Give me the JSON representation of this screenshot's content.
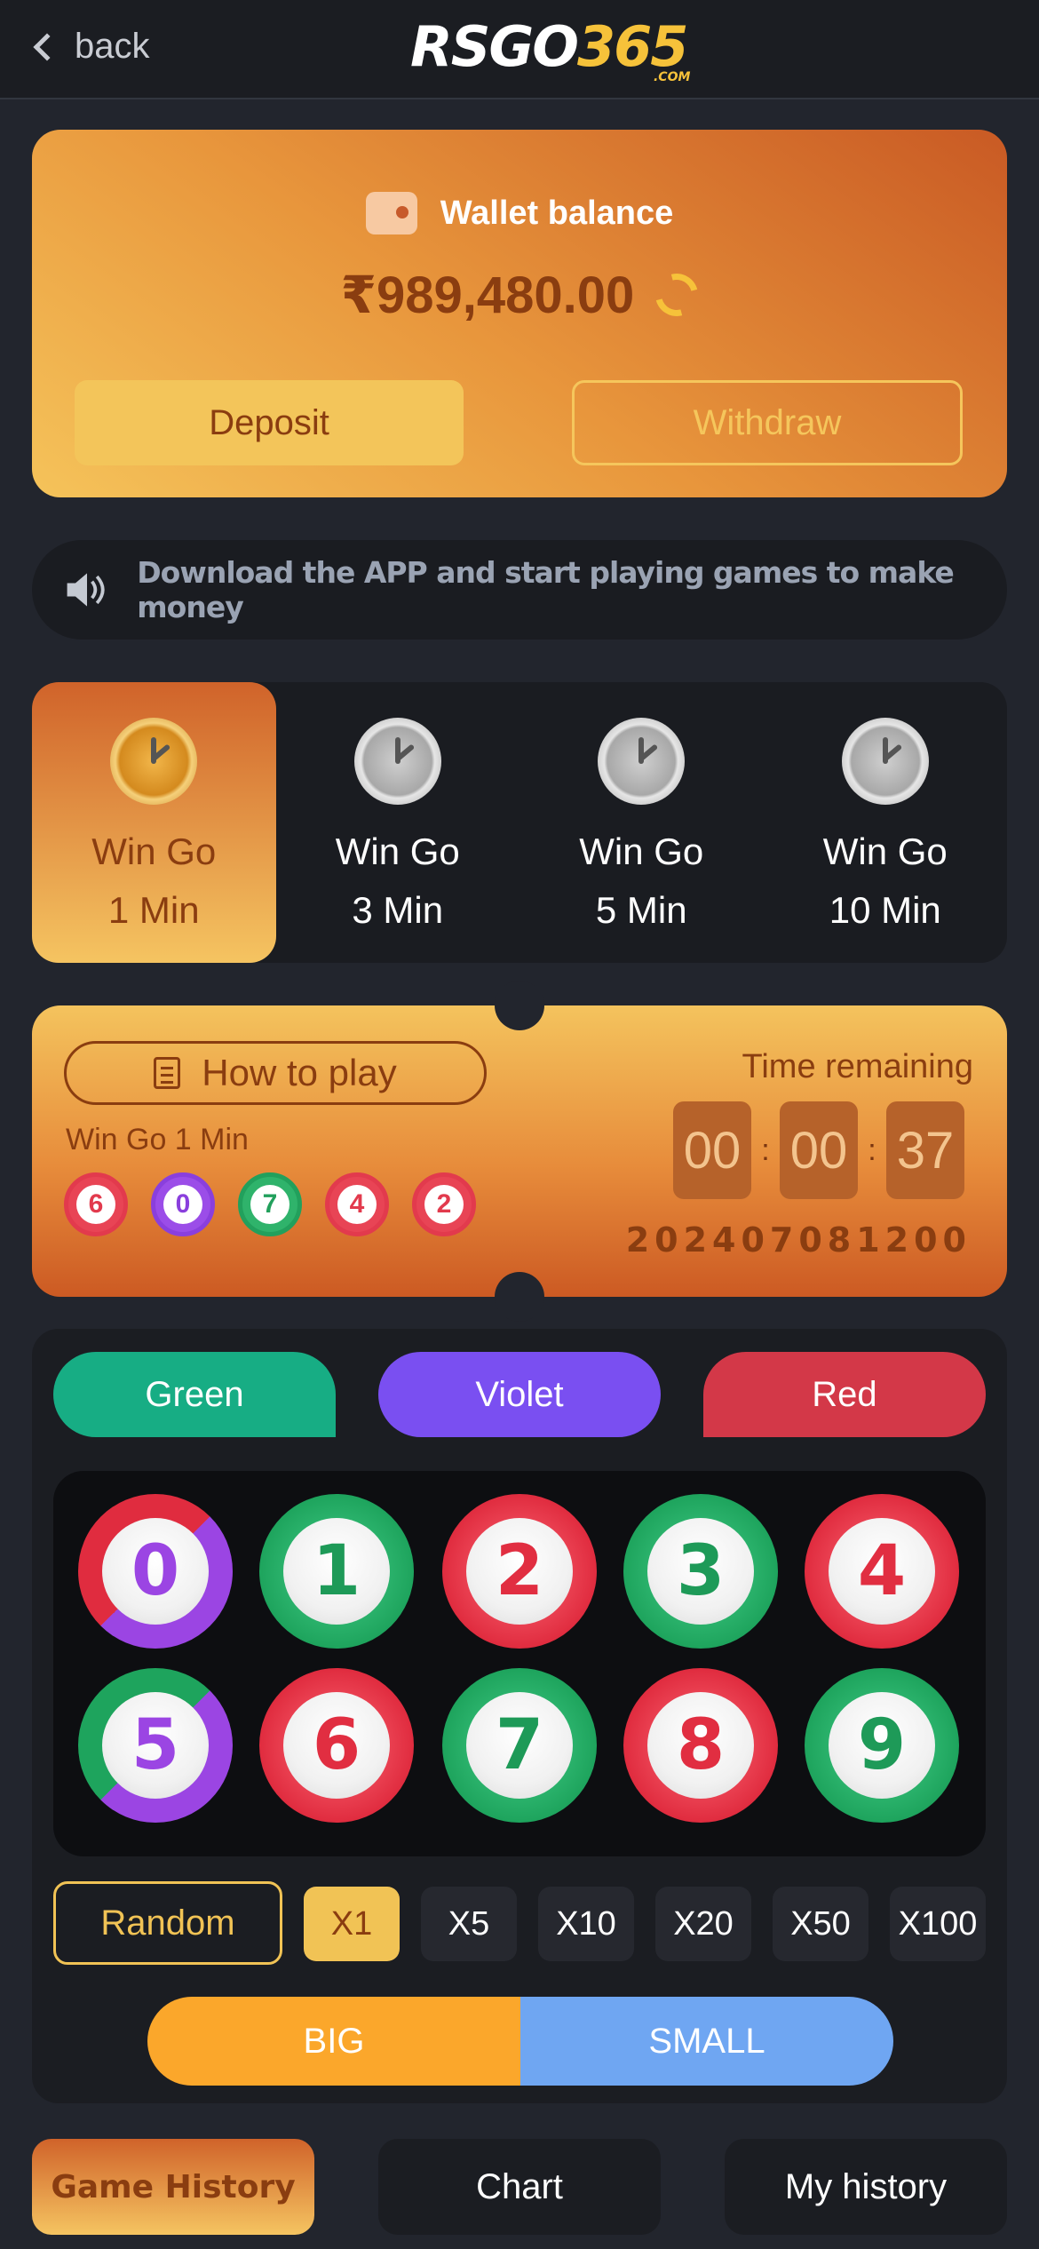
{
  "header": {
    "back_label": "back",
    "logo_main": "RSGO",
    "logo_num": "365",
    "logo_suffix": ".COM"
  },
  "wallet": {
    "title": "Wallet balance",
    "amount": "₹989,480.00",
    "deposit_label": "Deposit",
    "withdraw_label": "Withdraw"
  },
  "notice": {
    "text": "Download the APP and start playing games to make money"
  },
  "game_tabs": [
    {
      "line1": "Win Go",
      "line2": "1 Min",
      "active": true
    },
    {
      "line1": "Win Go",
      "line2": "3 Min",
      "active": false
    },
    {
      "line1": "Win Go",
      "line2": "5 Min",
      "active": false
    },
    {
      "line1": "Win Go",
      "line2": "10 Min",
      "active": false
    }
  ],
  "ticket": {
    "how_to_play": "How to play",
    "game_name": "Win Go 1 Min",
    "recent_results": [
      {
        "num": "6",
        "color": "red"
      },
      {
        "num": "0",
        "color": "violet"
      },
      {
        "num": "7",
        "color": "green"
      },
      {
        "num": "4",
        "color": "red"
      },
      {
        "num": "2",
        "color": "red"
      }
    ],
    "time_label": "Time remaining",
    "timer": {
      "h": "00",
      "m": "00",
      "s": "37",
      "sep": ":"
    },
    "period": "202407081200"
  },
  "bet": {
    "colors": {
      "green": "Green",
      "violet": "Violet",
      "red": "Red"
    },
    "numbers": [
      {
        "n": "0",
        "style": "rv"
      },
      {
        "n": "1",
        "style": "g"
      },
      {
        "n": "2",
        "style": "r"
      },
      {
        "n": "3",
        "style": "g"
      },
      {
        "n": "4",
        "style": "r"
      },
      {
        "n": "5",
        "style": "gv"
      },
      {
        "n": "6",
        "style": "r"
      },
      {
        "n": "7",
        "style": "g"
      },
      {
        "n": "8",
        "style": "r"
      },
      {
        "n": "9",
        "style": "g"
      }
    ],
    "random_label": "Random",
    "multipliers": [
      "X1",
      "X5",
      "X10",
      "X20",
      "X50",
      "X100"
    ],
    "big_label": "BIG",
    "small_label": "SMALL"
  },
  "bottom_tabs": {
    "history": "Game History",
    "chart": "Chart",
    "my_history": "My history"
  },
  "colors": {
    "accent_gold": "#f1c355",
    "green": "#17ad84",
    "violet": "#7a4ff1",
    "red": "#d33848",
    "big": "#fba72b",
    "small": "#6fa6f2"
  }
}
